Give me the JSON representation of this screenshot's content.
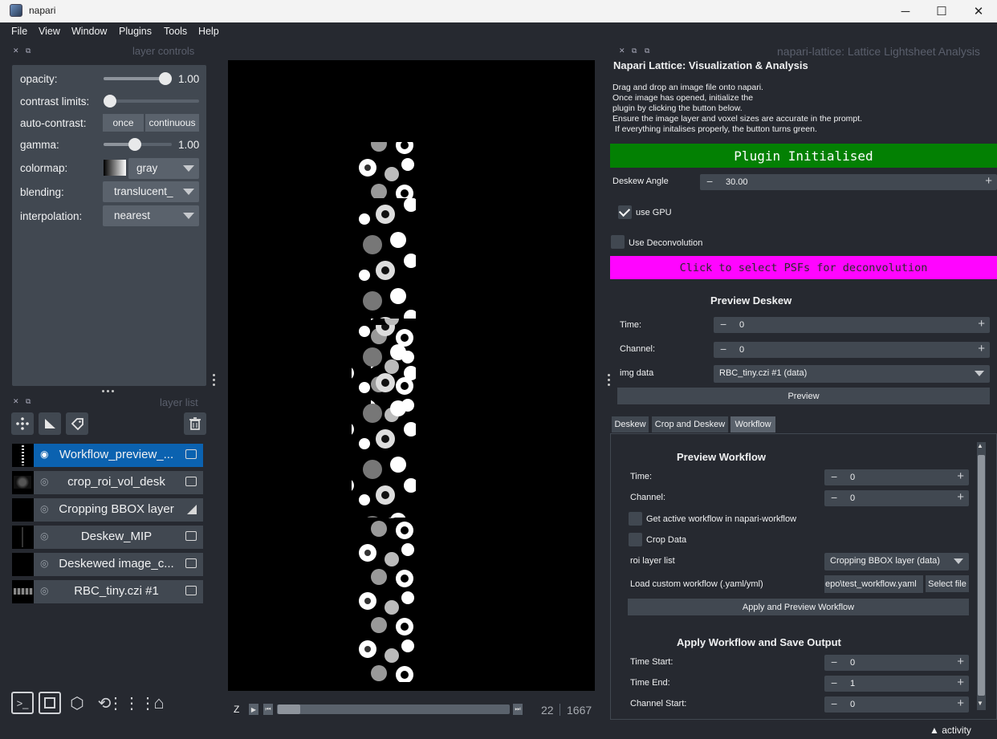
{
  "window": {
    "title": "napari",
    "min": "─",
    "max": "☐",
    "close": "✕"
  },
  "menu": [
    "File",
    "View",
    "Window",
    "Plugins",
    "Tools",
    "Help"
  ],
  "layer_controls": {
    "header": "layer controls",
    "opacity_label": "opacity:",
    "opacity_value": "1.00",
    "contrast_label": "contrast limits:",
    "autocontrast_label": "auto-contrast:",
    "once": "once",
    "continuous": "continuous",
    "gamma_label": "gamma:",
    "gamma_value": "1.00",
    "colormap_label": "colormap:",
    "colormap_value": "gray",
    "blending_label": "blending:",
    "blending_value": "translucent_",
    "interpolation_label": "interpolation:",
    "interpolation_value": "nearest"
  },
  "layer_list": {
    "header": "layer list",
    "layers": [
      {
        "name": "Workflow_preview_...",
        "selected": true,
        "visible": true,
        "type": "image"
      },
      {
        "name": "crop_roi_vol_desk",
        "selected": false,
        "visible": false,
        "type": "image"
      },
      {
        "name": "Cropping BBOX layer",
        "selected": false,
        "visible": false,
        "type": "shapes"
      },
      {
        "name": "Deskew_MIP",
        "selected": false,
        "visible": false,
        "type": "image"
      },
      {
        "name": "Deskewed image_c...",
        "selected": false,
        "visible": false,
        "type": "image"
      },
      {
        "name": "RBC_tiny.czi #1",
        "selected": false,
        "visible": false,
        "type": "image"
      }
    ]
  },
  "dims": {
    "axis": "Z",
    "current": "22",
    "max": "1667"
  },
  "plugin": {
    "dock_header": "napari-lattice: Lattice Lightsheet Analysis",
    "title": "Napari Lattice: Visualization & Analysis",
    "desc": [
      "Drag and drop an image file onto napari.",
      "Once image has opened, initialize the",
      "plugin by clicking the button below.",
      "Ensure the image layer and voxel sizes are accurate in the prompt.",
      " If everything initalises properly, the button turns green."
    ],
    "init_button": "Plugin Initialised",
    "init_color": "#038003",
    "deskew_angle_label": "Deskew Angle",
    "deskew_angle": "30.00",
    "use_gpu": "use GPU",
    "use_deconv": "Use Deconvolution",
    "psf_button": "Click to select PSFs for deconvolution",
    "psf_color": "#ff05ff",
    "preview_title": "Preview Deskew",
    "time_label": "Time:",
    "time_value": "0",
    "channel_label": "Channel:",
    "channel_value": "0",
    "img_label": "img data",
    "img_value": "RBC_tiny.czi #1 (data)",
    "preview_button": "Preview",
    "tabs": [
      "Deskew",
      "Crop and Deskew",
      "Workflow"
    ],
    "workflow": {
      "preview_title": "Preview Workflow",
      "time_label": "Time:",
      "time_value": "0",
      "channel_label": "Channel:",
      "channel_value": "0",
      "get_active": "Get active workflow in napari-workflow",
      "crop_data": "Crop Data",
      "roi_label": "roi layer list",
      "roi_value": "Cropping BBOX layer (data)",
      "load_label": "Load custom workflow (.yaml/yml)",
      "load_value": "epo\\test_workflow.yaml",
      "select_file": "Select file",
      "apply_preview": "Apply and Preview Workflow",
      "save_title": "Apply Workflow and Save Output",
      "time_start_label": "Time Start:",
      "time_start": "0",
      "time_end_label": "Time End:",
      "time_end": "1",
      "channel_start_label": "Channel Start:",
      "channel_start": "0"
    }
  },
  "activity": "activity"
}
